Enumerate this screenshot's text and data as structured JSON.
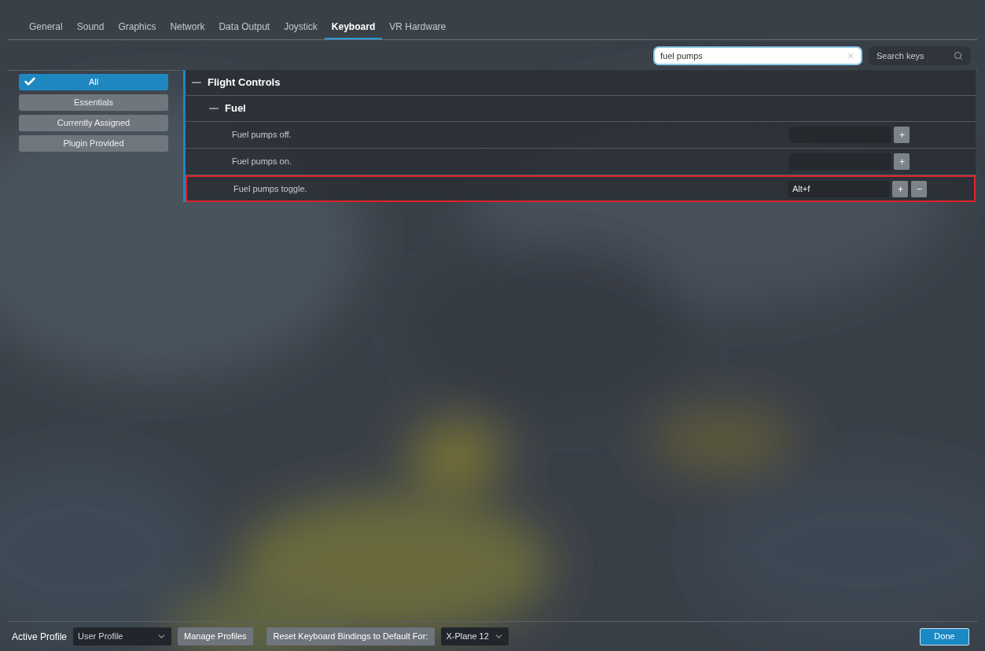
{
  "tabs": [
    {
      "label": "General",
      "selected": false
    },
    {
      "label": "Sound",
      "selected": false
    },
    {
      "label": "Graphics",
      "selected": false
    },
    {
      "label": "Network",
      "selected": false
    },
    {
      "label": "Data Output",
      "selected": false
    },
    {
      "label": "Joystick",
      "selected": false
    },
    {
      "label": "Keyboard",
      "selected": true
    },
    {
      "label": "VR Hardware",
      "selected": false
    }
  ],
  "search": {
    "value": "fuel pumps"
  },
  "key_search": {
    "placeholder": "Search keys"
  },
  "filters": [
    {
      "label": "All",
      "selected": true
    },
    {
      "label": "Essentials",
      "selected": false
    },
    {
      "label": "Currently Assigned",
      "selected": false
    },
    {
      "label": "Plugin Provided",
      "selected": false
    }
  ],
  "tree": [
    {
      "label": "Flight Controls",
      "expanded": true,
      "children": [
        {
          "label": "Fuel",
          "expanded": true,
          "commands": [
            {
              "label": "Fuel pumps off.",
              "highlighted": false
            },
            {
              "label": "Fuel pumps on.",
              "highlighted": false
            },
            {
              "label": "Fuel pumps toggle.",
              "binding": "Alt+f",
              "highlighted": true
            }
          ]
        }
      ]
    }
  ],
  "footer": {
    "profile_label": "Active Profile",
    "profile": "User Profile",
    "manage_button": "Manage Profiles",
    "reset_button": "Reset Keyboard Bindings to Default For:",
    "platform": "X-Plane 12",
    "done_button": "Done"
  }
}
